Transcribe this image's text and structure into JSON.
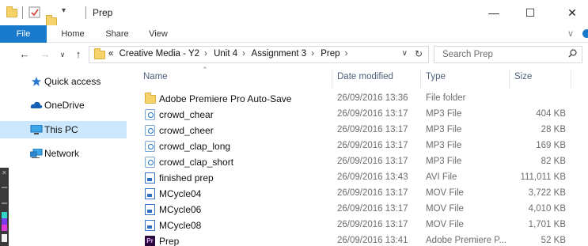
{
  "window": {
    "title": "Prep",
    "controls": {
      "minimize": "—",
      "maximize": "☐",
      "close": "✕"
    }
  },
  "ribbon": {
    "tabs": [
      "File",
      "Home",
      "Share",
      "View"
    ],
    "expand_glyph": "∨"
  },
  "address": {
    "overflow": "«",
    "crumbs": [
      "Creative Media - Y2",
      "Unit 4",
      "Assignment 3",
      "Prep"
    ],
    "separator": "›",
    "dropdown_glyph": "∨",
    "refresh_glyph": "↻"
  },
  "search": {
    "placeholder": "Search Prep"
  },
  "navpane": {
    "items": [
      {
        "label": "Quick access",
        "icon": "star-icon"
      },
      {
        "label": "OneDrive",
        "icon": "cloud-icon"
      },
      {
        "label": "This PC",
        "icon": "monitor-icon",
        "selected": true
      },
      {
        "label": "Network",
        "icon": "network-icon"
      }
    ]
  },
  "columns": {
    "name": "Name",
    "date": "Date modified",
    "type": "Type",
    "size": "Size"
  },
  "files": [
    {
      "name": "Adobe Premiere Pro Auto-Save",
      "date": "26/09/2016 13:36",
      "type": "File folder",
      "size": "",
      "icon": "folder-icon"
    },
    {
      "name": "crowd_chear",
      "date": "26/09/2016 13:17",
      "type": "MP3 File",
      "size": "404 KB",
      "icon": "audio-file-icon"
    },
    {
      "name": "crowd_cheer",
      "date": "26/09/2016 13:17",
      "type": "MP3 File",
      "size": "28 KB",
      "icon": "audio-file-icon"
    },
    {
      "name": "crowd_clap_long",
      "date": "26/09/2016 13:17",
      "type": "MP3 File",
      "size": "169 KB",
      "icon": "audio-file-icon"
    },
    {
      "name": "crowd_clap_short",
      "date": "26/09/2016 13:17",
      "type": "MP3 File",
      "size": "82 KB",
      "icon": "audio-file-icon"
    },
    {
      "name": "finished prep",
      "date": "26/09/2016 13:43",
      "type": "AVI File",
      "size": "111,011 KB",
      "icon": "video-file-icon"
    },
    {
      "name": "MCycle04",
      "date": "26/09/2016 13:17",
      "type": "MOV File",
      "size": "3,722 KB",
      "icon": "video-file-icon"
    },
    {
      "name": "MCycle06",
      "date": "26/09/2016 13:17",
      "type": "MOV File",
      "size": "4,010 KB",
      "icon": "video-file-icon"
    },
    {
      "name": "MCycle08",
      "date": "26/09/2016 13:17",
      "type": "MOV File",
      "size": "1,701 KB",
      "icon": "video-file-icon"
    },
    {
      "name": "Prep",
      "date": "26/09/2016 13:41",
      "type": "Adobe Premiere P...",
      "size": "52 KB",
      "icon": "premiere-project-icon"
    }
  ],
  "colors": {
    "accent": "#1979ca",
    "selected_nav": "#cce8ff",
    "header_text": "#4c607a"
  }
}
